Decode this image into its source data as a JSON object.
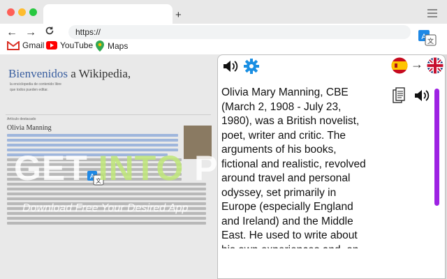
{
  "browser": {
    "url": "https://",
    "new_tab_label": "+",
    "bookmarks": [
      {
        "label": "Gmail"
      },
      {
        "label": "YouTube"
      },
      {
        "label": "Maps"
      }
    ]
  },
  "webpage": {
    "title_part1": "Bienvenidos",
    "title_part2": " a Wikipedia,",
    "subtitle1": "la enciclopedia de contenido libre",
    "subtitle2": "que todos pueden editar.",
    "section_label": "Artículo destacado",
    "article_heading": "Olivia Manning"
  },
  "translator": {
    "source_flag": "spanish-flag",
    "target_flag": "uk-flag",
    "arrow": "→",
    "translated_text": "Olivia Mary Manning, CBE (March 2, 1908 - July 23, 1980), was a British novelist, poet, writer and critic. The arguments of his books, fictional and realistic, revolved around travel and personal odyssey, set primarily in Europe (especially England and Ireland) and the Middle East. He used to write about his own experiences and, on occasion, he also appealed to",
    "scrollbar_color": "#9d22e3"
  },
  "watermark": {
    "text_left": "GET ",
    "text_mid": "INTO",
    "text_right": " PC",
    "tagline": "Download Free Your Desired App"
  }
}
